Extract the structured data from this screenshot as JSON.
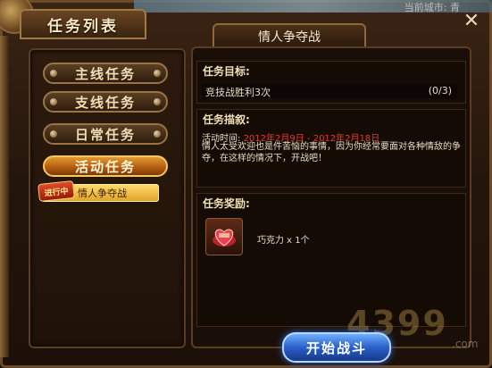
{
  "window": {
    "top_text": "当前城市: 青",
    "list_tab": "任务列表",
    "close": "✕"
  },
  "categories": [
    {
      "label": "主线任务",
      "active": false
    },
    {
      "label": "支线任务",
      "active": false
    },
    {
      "label": "日常任务",
      "active": false
    },
    {
      "label": "活动任务",
      "active": true
    }
  ],
  "quest_list": {
    "badge": "进行中",
    "item": "情人争夺战"
  },
  "detail": {
    "title": "情人争夺战",
    "goal_header": "任务目标:",
    "goal_text": "竞技战胜利3次",
    "goal_progress": "(0/3)",
    "desc_header": "任务描叙:",
    "time_label": "活动时间:",
    "time_range": "2012年2月9日 - 2012年2月18日",
    "desc_body": "情人太受欢迎也是件苦恼的事情，因为你经常要面对各种情敌的争夺，在这样的情况下，开战吧！",
    "reward_header": "任务奖励:",
    "reward_item": "巧克力 x 1个"
  },
  "actions": {
    "start": "开始战斗"
  },
  "watermark": {
    "main": "4399",
    "com": ".com"
  },
  "colors": {
    "active_orange": "#e09a30",
    "highlight_yellow": "#ffd96a",
    "date_red": "#e33b2a",
    "start_blue": "#2a5fc8"
  }
}
